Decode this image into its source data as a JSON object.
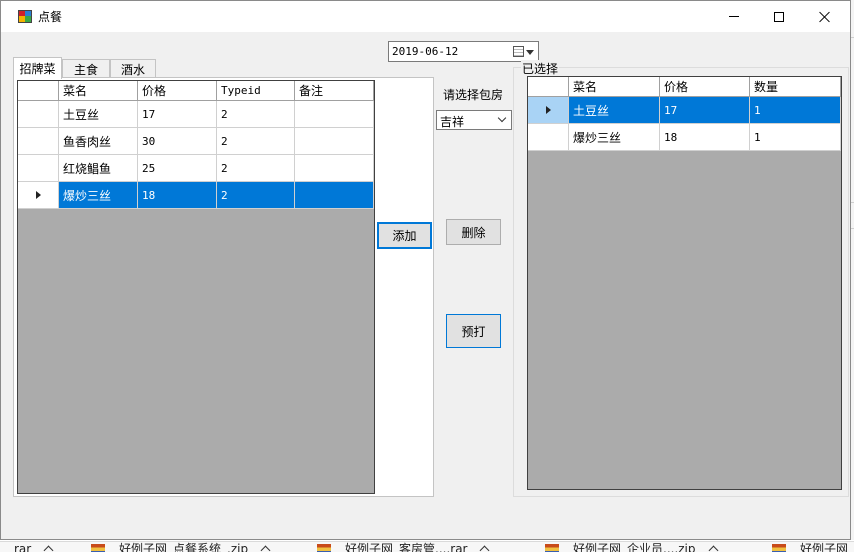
{
  "window": {
    "title": "点餐"
  },
  "date_picker": {
    "value": "2019-06-12"
  },
  "tabs": [
    {
      "label": "招牌菜",
      "active": true
    },
    {
      "label": "主食",
      "active": false
    },
    {
      "label": "酒水",
      "active": false
    }
  ],
  "menu_grid": {
    "columns": [
      "菜名",
      "价格",
      "Typeid",
      "备注"
    ],
    "rows": [
      {
        "name": "土豆丝",
        "price": "17",
        "typeid": "2",
        "note": ""
      },
      {
        "name": "鱼香肉丝",
        "price": "30",
        "typeid": "2",
        "note": ""
      },
      {
        "name": "红烧鲳鱼",
        "price": "25",
        "typeid": "2",
        "note": ""
      },
      {
        "name": "爆炒三丝",
        "price": "18",
        "typeid": "2",
        "note": ""
      }
    ],
    "selected_row": 3
  },
  "room": {
    "label": "请选择包房",
    "selected": "吉祥"
  },
  "buttons": {
    "add": "添加",
    "delete": "删除",
    "print": "预打"
  },
  "selected_group": {
    "title": "已选择",
    "columns": [
      "菜名",
      "价格",
      "数量"
    ],
    "rows": [
      {
        "name": "土豆丝",
        "price": "17",
        "qty": "1"
      },
      {
        "name": "爆炒三丝",
        "price": "18",
        "qty": "1"
      }
    ],
    "selected_row": 0
  },
  "taskbar": {
    "items": [
      {
        "label": "rar"
      },
      {
        "label": "好例子网_点餐系统_.zip"
      },
      {
        "label": "好例子网_客房管....rar"
      },
      {
        "label": "好例子网_企业员....zip"
      },
      {
        "label": "好例子网"
      }
    ]
  },
  "colors": {
    "selection": "#0078d7",
    "grid_background": "#ababab",
    "window_background": "#f0f0f0"
  }
}
